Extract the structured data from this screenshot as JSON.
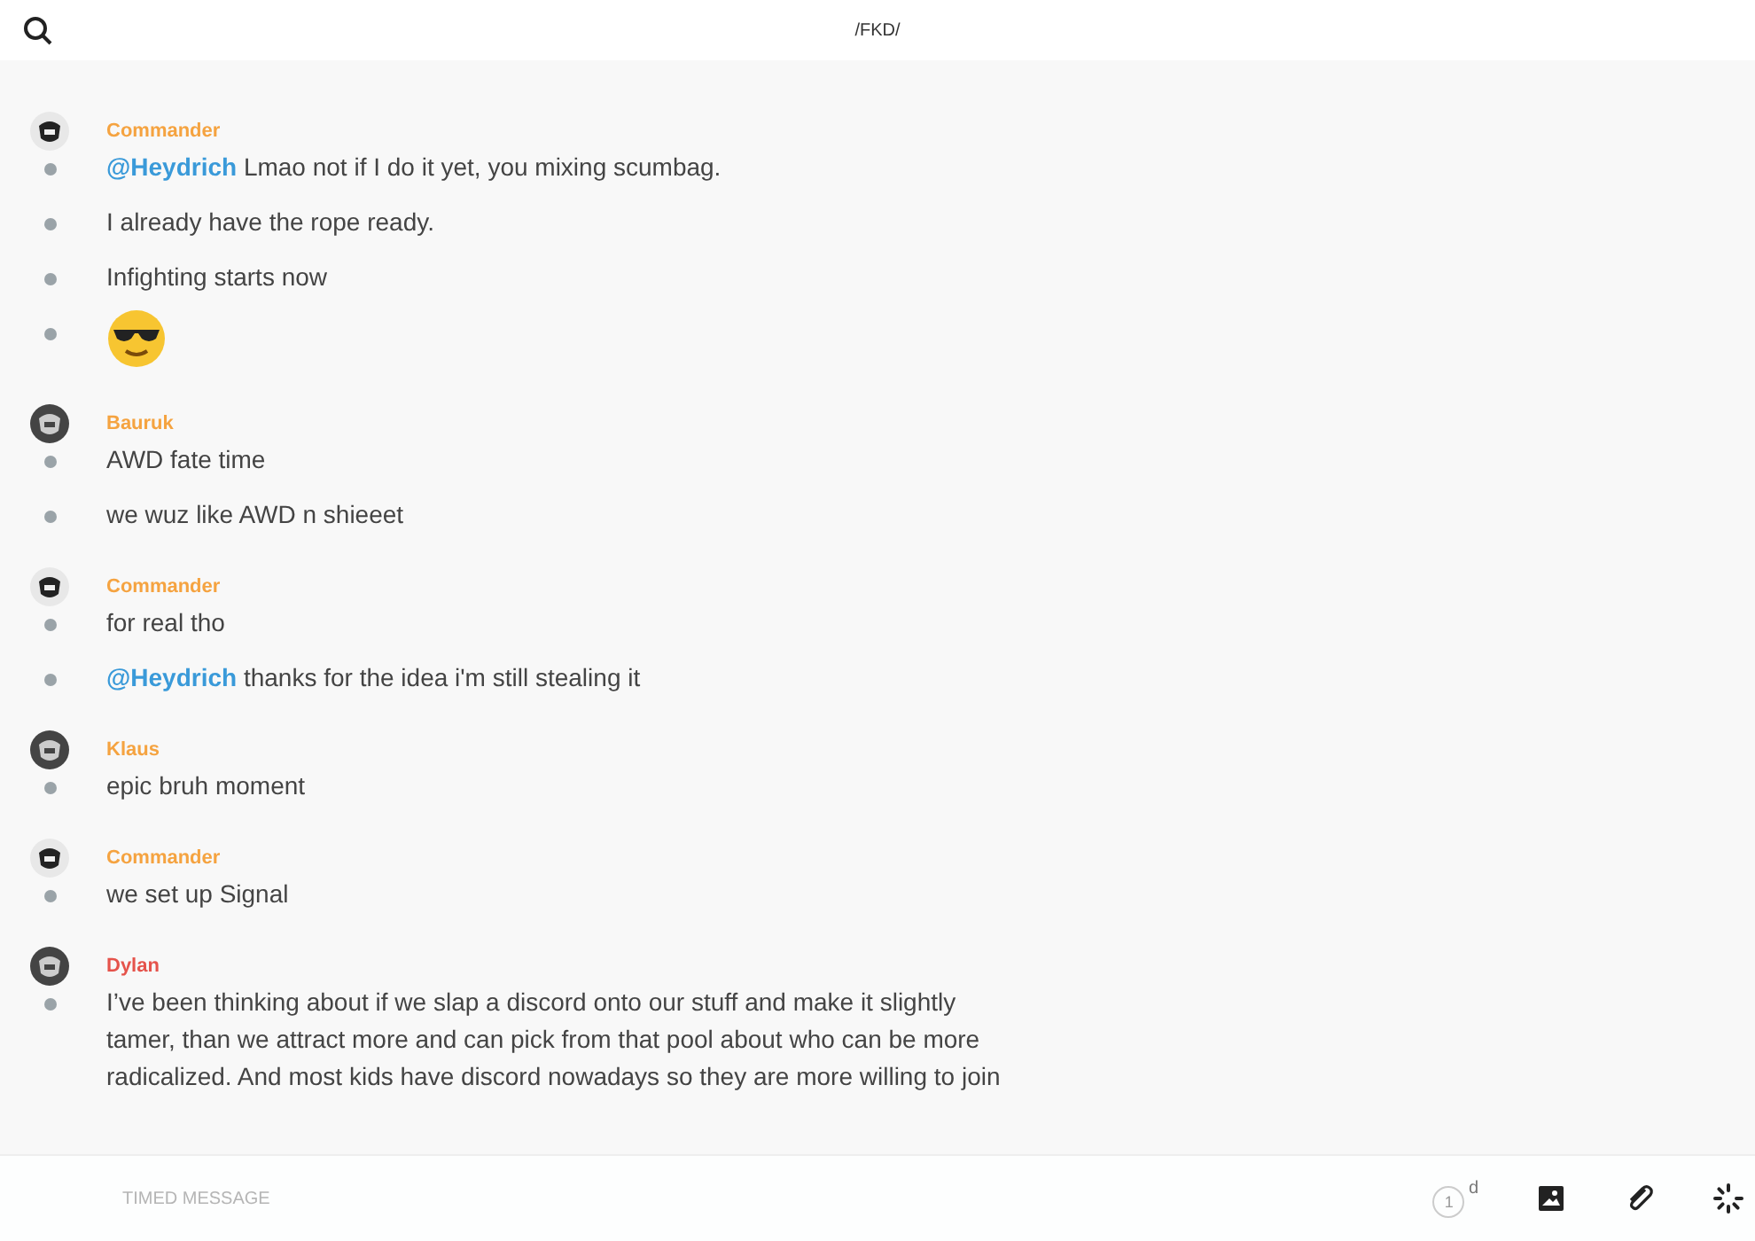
{
  "header": {
    "title": "/FKD/"
  },
  "groups": [
    {
      "author": "Commander",
      "color": "#f5a340",
      "messages": [
        {
          "kind": "text",
          "text": "**@Heydrich** Lmao not if I do it yet, you mixing scumbag."
        },
        {
          "kind": "text",
          "text": "I already have the rope ready."
        },
        {
          "kind": "text",
          "text": "Infighting starts now"
        },
        {
          "kind": "emoji"
        }
      ]
    },
    {
      "author": "Bauruk",
      "color": "#f5a340",
      "messages": [
        {
          "kind": "text",
          "text": "AWD fate time"
        },
        {
          "kind": "text",
          "text": "we wuz like AWD n shieeet"
        }
      ]
    },
    {
      "author": "Commander",
      "color": "#f5a340",
      "messages": [
        {
          "kind": "text",
          "text": "for real tho"
        },
        {
          "kind": "text",
          "text": "**@Heydrich** thanks for the idea i'm still stealing it"
        }
      ]
    },
    {
      "author": "Klaus",
      "color": "#f5a340",
      "messages": [
        {
          "kind": "text",
          "text": "epic bruh moment"
        }
      ]
    },
    {
      "author": "Commander",
      "color": "#f5a340",
      "messages": [
        {
          "kind": "text",
          "text": "we set up Signal"
        }
      ]
    },
    {
      "author": "Dylan",
      "color": "#e5534b",
      "messages": [
        {
          "kind": "text",
          "text": "I’ve been thinking about if we slap a discord onto our stuff and make it slightly tamer, than we attract more and can pick from that pool about who can be more radicalized. And most kids have discord nowadays so they are more willing to join"
        }
      ]
    }
  ],
  "composer": {
    "placeholder": "TIMED MESSAGE",
    "timer": "1",
    "timer_unit": "d"
  }
}
